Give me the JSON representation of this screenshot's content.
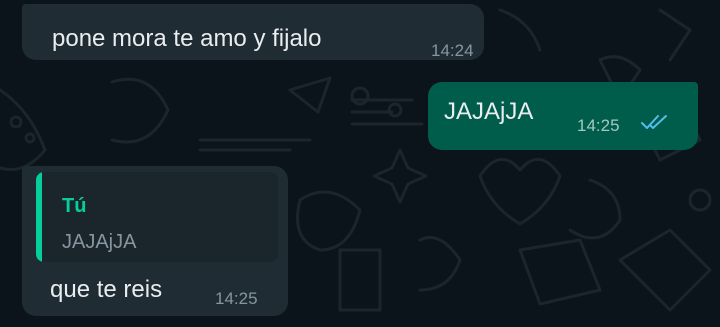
{
  "colors": {
    "background": "#0b141a",
    "incoming_bubble": "#1f2c34",
    "outgoing_bubble": "#005c4b",
    "quote_accent": "#06cf9c",
    "read_ticks": "#53bdeb"
  },
  "messages": [
    {
      "direction": "incoming",
      "text": "pone mora te amo y fijalo",
      "time": "14:24"
    },
    {
      "direction": "outgoing",
      "text": "JAJAjJA",
      "time": "14:25",
      "status_icon": "double-check-read-icon"
    },
    {
      "direction": "incoming",
      "quote": {
        "author": "Tú",
        "text": "JAJAjJA"
      },
      "text": "que te reis",
      "time": "14:25"
    }
  ]
}
